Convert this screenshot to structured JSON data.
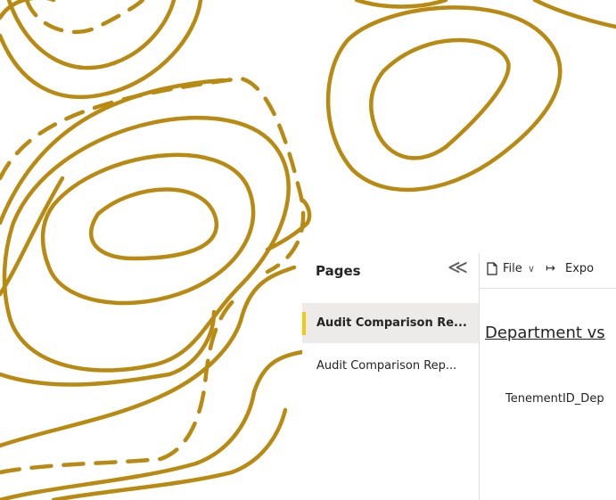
{
  "pages_panel": {
    "title": "Pages",
    "collapse_icon": "chevron-double-left-icon",
    "items": [
      {
        "label": "Audit Comparison Re...",
        "active": true
      },
      {
        "label": "Audit Comparison Rep...",
        "active": false
      }
    ]
  },
  "toolbar": {
    "file_label": "File",
    "file_dropdown": "∨",
    "export_label": "Expo",
    "export_icon": "↦"
  },
  "report": {
    "title": "Department vs",
    "field_label": "TenementID_Dep"
  },
  "colors": {
    "contour_stroke": "#b8860b",
    "active_marker": "#f2c811",
    "selected_bg": "#edebe9"
  }
}
